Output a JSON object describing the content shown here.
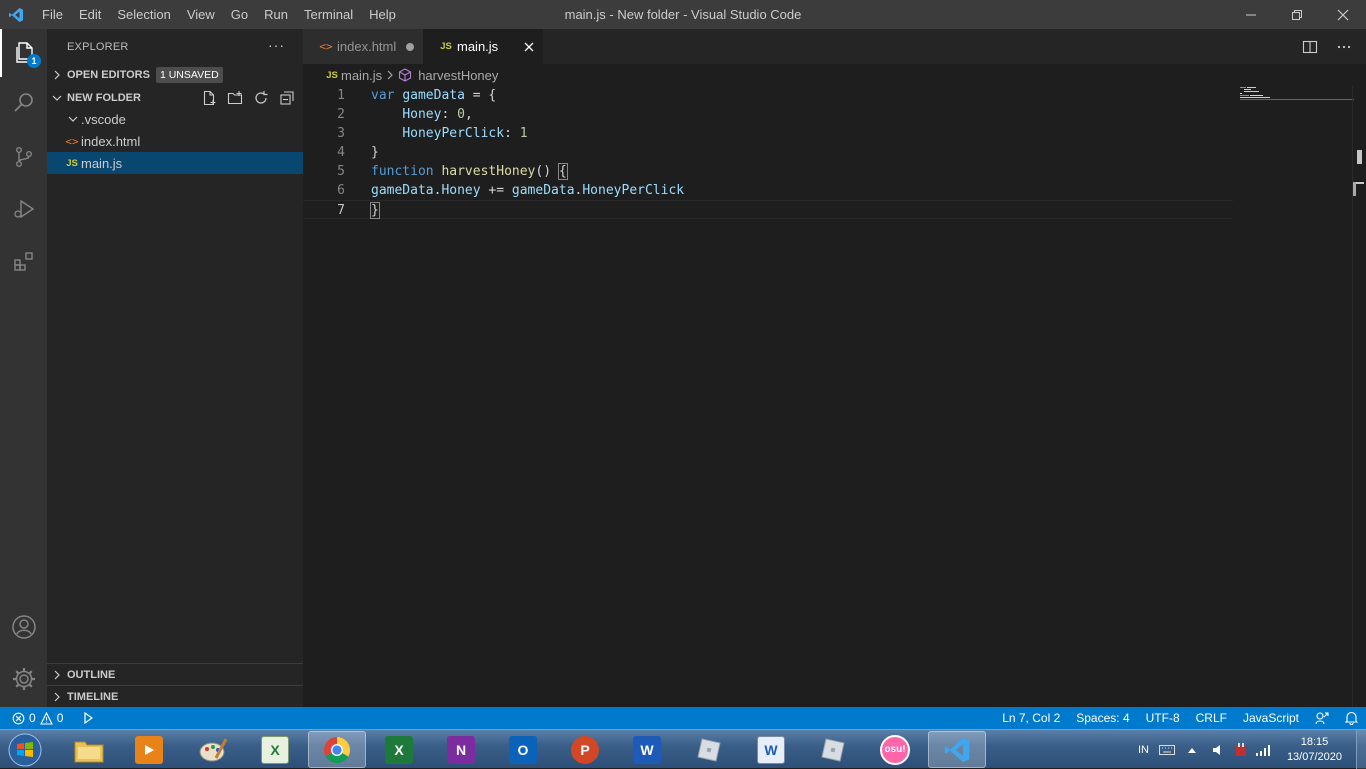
{
  "window": {
    "title": "main.js - New folder - Visual Studio Code"
  },
  "menu": [
    "File",
    "Edit",
    "Selection",
    "View",
    "Go",
    "Run",
    "Terminal",
    "Help"
  ],
  "activity_bar": {
    "explorer_badge": "1"
  },
  "sidebar": {
    "title": "EXPLORER",
    "more": "···",
    "open_editors": "OPEN EDITORS",
    "unsaved_badge": "1 UNSAVED",
    "folder": "NEW FOLDER",
    "items": [
      {
        "label": ".vscode",
        "type": "folder"
      },
      {
        "label": "index.html",
        "type": "html"
      },
      {
        "label": "main.js",
        "type": "js"
      }
    ],
    "outline": "OUTLINE",
    "timeline": "TIMELINE"
  },
  "tabs": [
    {
      "label": "index.html",
      "icon": "<>",
      "state": "unsaved-dot"
    },
    {
      "label": "main.js",
      "icon": "JS",
      "state": "close"
    }
  ],
  "breadcrumb": {
    "file": "main.js",
    "symbol": "harvestHoney"
  },
  "editor": {
    "line_numbers": [
      "1",
      "2",
      "3",
      "4",
      "5",
      "6",
      "7"
    ],
    "lines": [
      [
        {
          "t": "var",
          "c": "kw"
        },
        {
          "t": " ",
          "c": "pun"
        },
        {
          "t": "gameData",
          "c": "var"
        },
        {
          "t": " = {",
          "c": "pun"
        }
      ],
      [
        {
          "t": "    ",
          "c": "pun"
        },
        {
          "t": "Honey",
          "c": "var"
        },
        {
          "t": ": ",
          "c": "pun"
        },
        {
          "t": "0",
          "c": "num"
        },
        {
          "t": ",",
          "c": "pun"
        }
      ],
      [
        {
          "t": "    ",
          "c": "pun"
        },
        {
          "t": "HoneyPerClick",
          "c": "var"
        },
        {
          "t": ": ",
          "c": "pun"
        },
        {
          "t": "1",
          "c": "num"
        }
      ],
      [
        {
          "t": "}",
          "c": "pun"
        }
      ],
      [
        {
          "t": "function",
          "c": "kw"
        },
        {
          "t": " ",
          "c": "pun"
        },
        {
          "t": "harvestHoney",
          "c": "fn"
        },
        {
          "t": "() ",
          "c": "pun"
        },
        {
          "t": "{",
          "c": "pun bracket-hl"
        }
      ],
      [
        {
          "t": "gameData",
          "c": "var"
        },
        {
          "t": ".",
          "c": "pun"
        },
        {
          "t": "Honey",
          "c": "var"
        },
        {
          "t": " += ",
          "c": "pun"
        },
        {
          "t": "gameData",
          "c": "var"
        },
        {
          "t": ".",
          "c": "pun"
        },
        {
          "t": "HoneyPerClick",
          "c": "var"
        }
      ],
      [
        {
          "t": "}",
          "c": "pun bracket-hl"
        }
      ]
    ]
  },
  "status_bar": {
    "errors": "0",
    "warnings": "0",
    "position": "Ln 7, Col 2",
    "spaces": "Spaces: 4",
    "encoding": "UTF-8",
    "eol": "CRLF",
    "language": "JavaScript"
  },
  "taskbar": {
    "lang": "IN",
    "time": "18:15",
    "date": "13/07/2020",
    "apps": [
      "explorer",
      "media-player",
      "paint",
      "excel-legacy",
      "chrome",
      "excel",
      "onenote",
      "outlook",
      "powerpoint",
      "word",
      "roblox",
      "word-legacy",
      "roblox-studio",
      "osu",
      "vscode"
    ],
    "osu_label": "osu!"
  },
  "colors": {
    "accent": "#007acc",
    "titlebar": "#3c3c3c",
    "activitybar": "#333333",
    "sidebar": "#252526",
    "editor": "#1e1e1e",
    "selection": "#094771"
  }
}
